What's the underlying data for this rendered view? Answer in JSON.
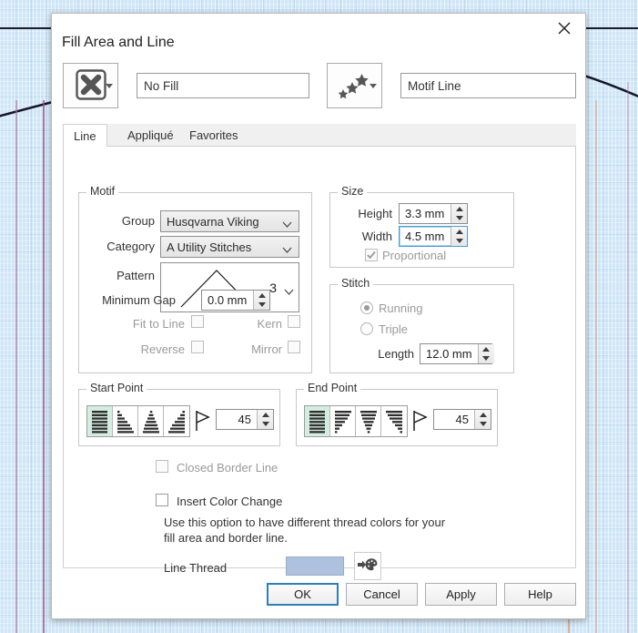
{
  "dialog": {
    "title": "Fill Area and Line",
    "close_icon": "close-icon"
  },
  "top": {
    "fill_icon": "no-fill-x-icon",
    "fill_value": "No Fill",
    "line_icon": "motif-stars-icon",
    "line_value": "Motif Line"
  },
  "tabs": [
    {
      "label": "Line",
      "active": true
    },
    {
      "label": "Appliqué",
      "active": false
    },
    {
      "label": "Favorites",
      "active": false
    }
  ],
  "motif": {
    "legend": "Motif",
    "group_label": "Group",
    "group_value": "Husqvarna Viking",
    "category_label": "Category",
    "category_value": "A Utility Stitches",
    "pattern_label": "Pattern",
    "pattern_value": "3",
    "min_gap_label": "Minimum Gap",
    "min_gap_value": "0.0 mm",
    "fit_to_line_label": "Fit to Line",
    "fit_to_line_checked": false,
    "kern_label": "Kern",
    "kern_checked": false,
    "reverse_label": "Reverse",
    "reverse_checked": false,
    "mirror_label": "Mirror",
    "mirror_checked": false
  },
  "size": {
    "legend": "Size",
    "height_label": "Height",
    "height_value": "3.3 mm",
    "width_label": "Width",
    "width_value": "4.5 mm",
    "proportional_label": "Proportional",
    "proportional_checked": true
  },
  "stitch": {
    "legend": "Stitch",
    "running_label": "Running",
    "triple_label": "Triple",
    "selected": "Running",
    "length_label": "Length",
    "length_value": "12.0 mm"
  },
  "start_point": {
    "legend": "Start Point",
    "angle_value": "45",
    "selected_index": 0,
    "options": [
      "start-left-aligned-icon",
      "start-triangle-right-icon",
      "start-center-icon",
      "start-triangle-left-icon"
    ]
  },
  "end_point": {
    "legend": "End Point",
    "angle_value": "45",
    "selected_index": 0,
    "options": [
      "end-left-aligned-icon",
      "end-triangle-right-icon",
      "end-center-icon",
      "end-triangle-left-icon"
    ]
  },
  "options": {
    "closed_border_label": "Closed Border Line",
    "closed_border_checked": false,
    "insert_color_change_label": "Insert Color Change",
    "insert_color_change_checked": false,
    "help_line_1": "Use this option to have different thread colors for your",
    "help_line_2": "fill area and border line.",
    "line_thread_label": "Line Thread",
    "line_thread_color": "#aec1de",
    "palette_icon": "color-palette-icon"
  },
  "footer": {
    "ok": "OK",
    "cancel": "Cancel",
    "apply": "Apply",
    "help": "Help"
  }
}
